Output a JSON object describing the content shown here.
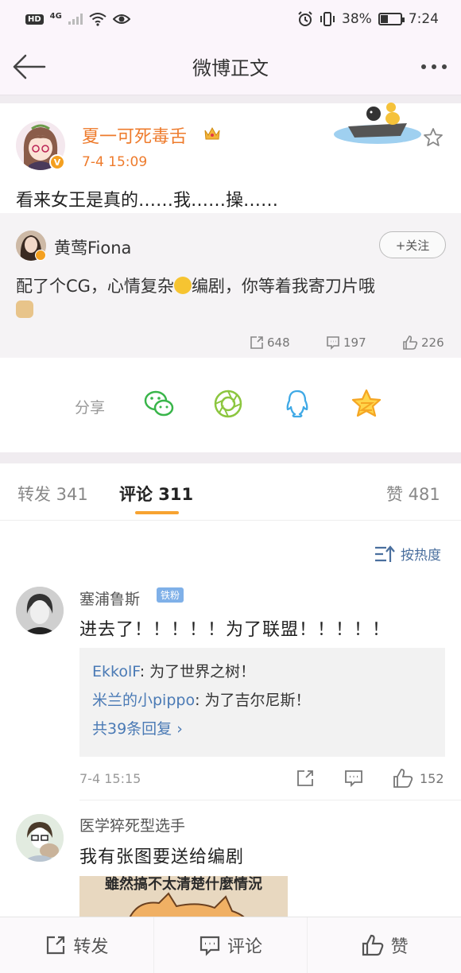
{
  "status_bar": {
    "hd": "HD",
    "network": "4G",
    "battery": "38%",
    "battery_level": 0.38,
    "time": "7:24"
  },
  "nav": {
    "title": "微博正文"
  },
  "post": {
    "author": "夏一可死毒舌",
    "time": "7-4 15:09",
    "text": "看来女王是真的……我……操……",
    "repost": {
      "user": "黄莺Fiona",
      "follow_label": "+关注",
      "text_before": "配了个CG，心情复杂",
      "text_after": "编剧，你等着我寄刀片哦",
      "stats": {
        "reposts": "648",
        "comments": "197",
        "likes": "226"
      }
    }
  },
  "share": {
    "label": "分享",
    "targets": [
      "wechat-icon",
      "moments-icon",
      "qq-icon",
      "qzone-icon"
    ]
  },
  "tabs": {
    "repost": "转发 341",
    "comments": "评论 311",
    "likes": "赞 481"
  },
  "sort": {
    "label": "按热度"
  },
  "comments": [
    {
      "user": "塞浦鲁斯",
      "badge": "铁粉",
      "text": "进去了！！！！！为了联盟！！！！！",
      "replies": [
        {
          "user": "EkkolF",
          "text": ": 为了世界之树！"
        },
        {
          "user": "米兰的小pippo",
          "text": ": 为了吉尔尼斯！"
        }
      ],
      "more_replies": "共39条回复 ›",
      "time": "7-4 15:15",
      "likes": "152"
    },
    {
      "user": "医学猝死型选手",
      "text": "我有张图要送给编剧",
      "image_caption": "雖然搞不太清楚什麼情況"
    }
  ],
  "bottom_bar": {
    "repost": "转发",
    "comment": "评论",
    "like": "赞"
  },
  "colors": {
    "orange": "#ee7b2c",
    "link_blue": "#4a7ab5",
    "tab_accent": "#f7a331"
  }
}
